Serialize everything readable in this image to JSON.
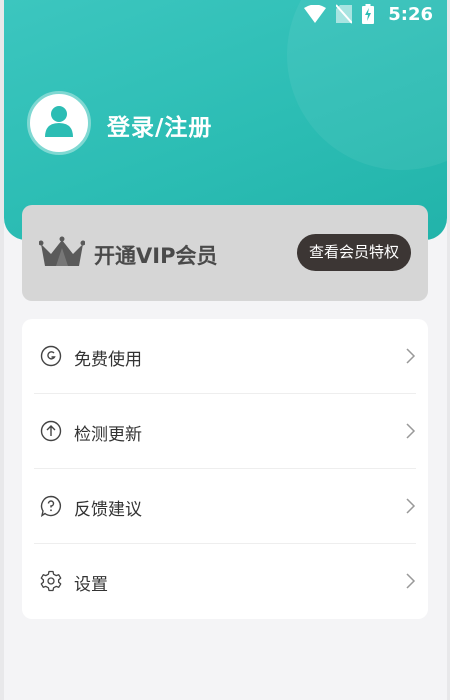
{
  "status_bar": {
    "time": "5:26",
    "icons": [
      "wifi-icon",
      "no-sim-icon",
      "battery-charging-icon"
    ]
  },
  "profile": {
    "avatar_icon": "user-icon",
    "login_label": "登录/注册"
  },
  "vip": {
    "icon": "crown-icon",
    "title": "开通VIP会员",
    "button_label": "查看会员特权"
  },
  "menu": {
    "items": [
      {
        "icon": "g-circle-icon",
        "label": "免费使用"
      },
      {
        "icon": "upload-arrow-icon",
        "label": "检测更新"
      },
      {
        "icon": "help-bubble-icon",
        "label": "反馈建议"
      },
      {
        "icon": "settings-gear-icon",
        "label": "设置"
      }
    ]
  },
  "colors": {
    "header_teal": "#2cbdb4",
    "vip_card": "#d6d6d6",
    "vip_button": "#3c3634",
    "background": "#f4f4f6"
  }
}
